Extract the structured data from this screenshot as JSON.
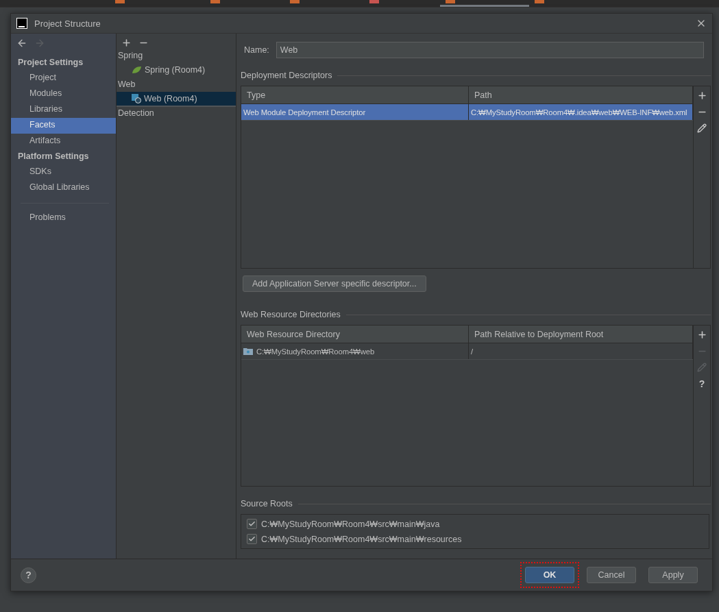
{
  "window": {
    "title": "Project Structure"
  },
  "nav": {
    "back_disabled": false,
    "forward_disabled": true
  },
  "sidebar": {
    "groups": [
      {
        "title": "Project Settings",
        "items": [
          {
            "label": "Project",
            "selected": false
          },
          {
            "label": "Modules",
            "selected": false
          },
          {
            "label": "Libraries",
            "selected": false
          },
          {
            "label": "Facets",
            "selected": true
          },
          {
            "label": "Artifacts",
            "selected": false
          }
        ]
      },
      {
        "title": "Platform Settings",
        "items": [
          {
            "label": "SDKs",
            "selected": false
          },
          {
            "label": "Global Libraries",
            "selected": false
          }
        ]
      }
    ],
    "extra_items": [
      {
        "label": "Problems",
        "selected": false
      }
    ]
  },
  "facets_tree": [
    {
      "label": "Spring",
      "children": [
        {
          "label": "Spring (Room4)",
          "kind": "spring",
          "selected": false
        }
      ]
    },
    {
      "label": "Web",
      "children": [
        {
          "label": "Web (Room4)",
          "kind": "web",
          "selected": true
        }
      ]
    },
    {
      "label": "Detection"
    }
  ],
  "name_field": {
    "label": "Name:",
    "value": "Web"
  },
  "deployment_descriptors": {
    "title": "Deployment Descriptors",
    "columns": [
      "Type",
      "Path"
    ],
    "rows": [
      {
        "cells": [
          "Web Module Deployment Descriptor",
          "C:₩MyStudyRoom₩Room4₩.idea₩web₩WEB-INF₩web.xml"
        ],
        "selected": true
      }
    ],
    "tools": [
      {
        "kind": "add",
        "disabled": false
      },
      {
        "kind": "remove",
        "disabled": false
      },
      {
        "kind": "edit",
        "disabled": false
      }
    ],
    "add_button": "Add Application Server specific descriptor..."
  },
  "web_resources": {
    "title": "Web Resource Directories",
    "columns": [
      "Web Resource Directory",
      "Path Relative to Deployment Root"
    ],
    "rows": [
      {
        "cells": [
          "C:₩MyStudyRoom₩Room4₩web",
          "/"
        ],
        "selected": false
      }
    ],
    "tools": [
      {
        "kind": "add",
        "disabled": false
      },
      {
        "kind": "remove",
        "disabled": true
      },
      {
        "kind": "edit",
        "disabled": true
      },
      {
        "kind": "help",
        "label": "?",
        "disabled": false
      }
    ]
  },
  "source_roots": {
    "title": "Source Roots",
    "items": [
      {
        "path": "C:₩MyStudyRoom₩Room4₩src₩main₩java",
        "checked": true
      },
      {
        "path": "C:₩MyStudyRoom₩Room4₩src₩main₩resources",
        "checked": true
      }
    ]
  },
  "footer": {
    "help": "?",
    "buttons": [
      {
        "label": "OK",
        "kind": "primary",
        "highlighted": true
      },
      {
        "label": "Cancel",
        "kind": "normal",
        "highlighted": false
      },
      {
        "label": "Apply",
        "kind": "normal",
        "highlighted": false
      }
    ]
  }
}
